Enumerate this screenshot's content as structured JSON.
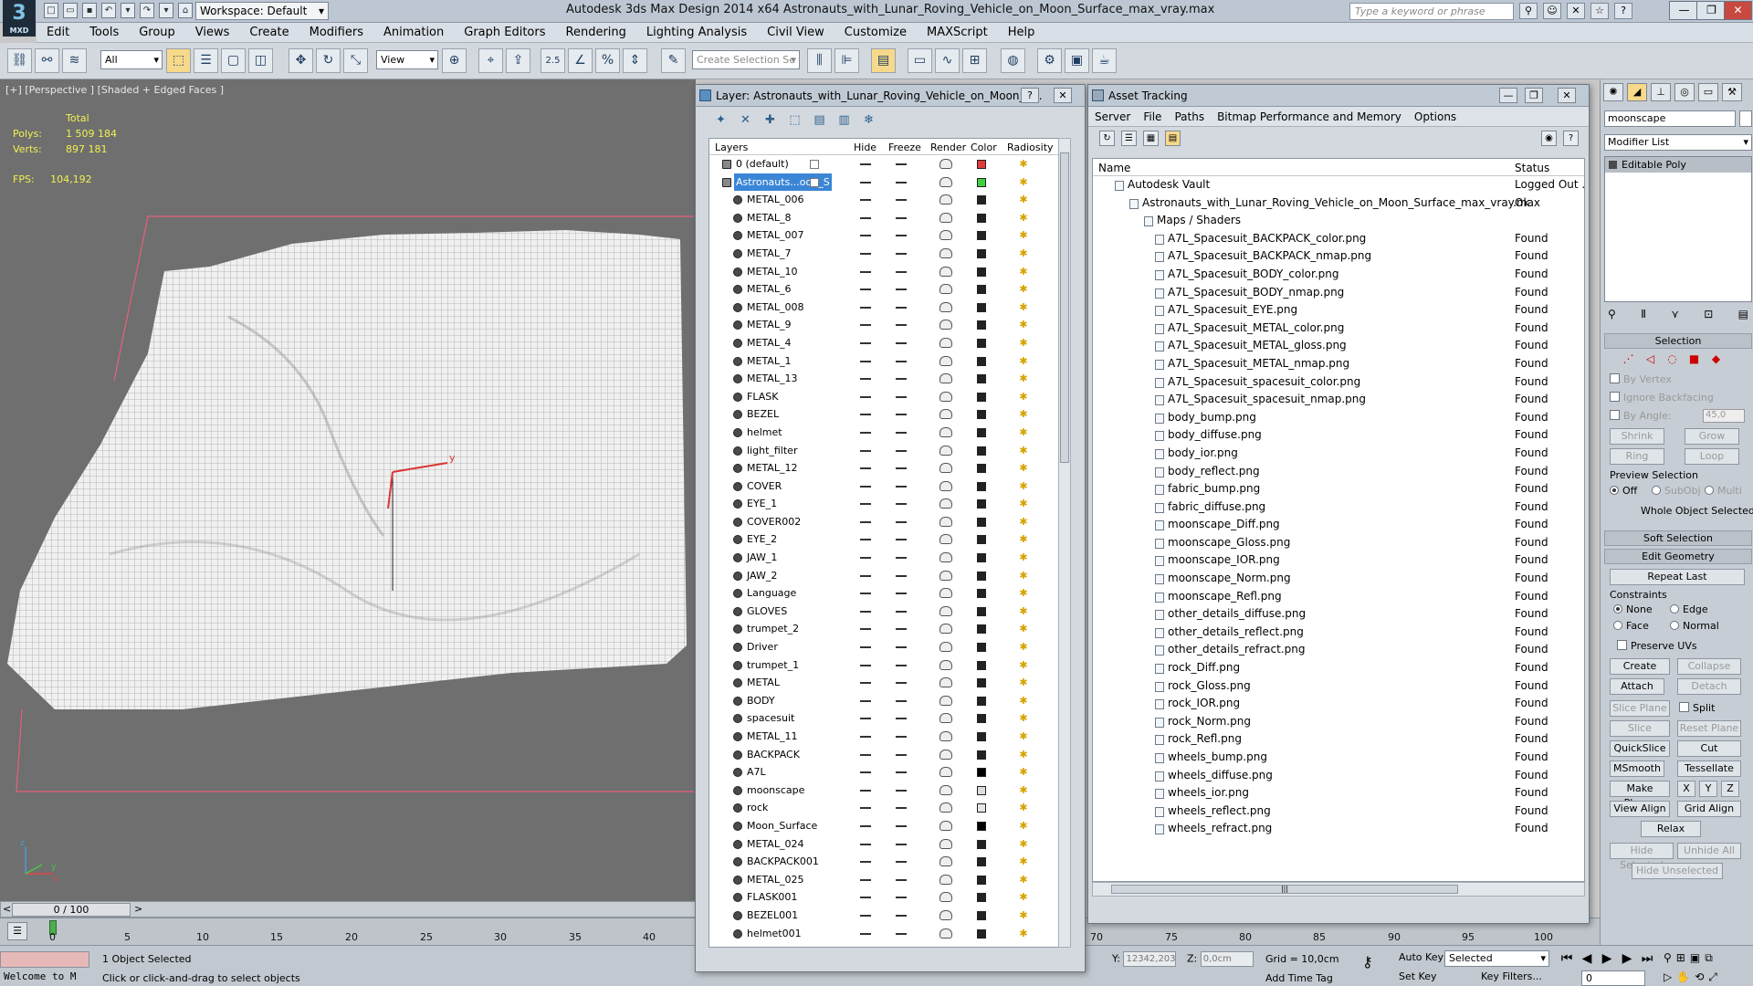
{
  "title": {
    "app_logo": "MXD",
    "workspace": "Workspace: Default",
    "window_title": "Autodesk 3ds Max Design 2014 x64     Astronauts_with_Lunar_Roving_Vehicle_on_Moon_Surface_max_vray.max",
    "search_placeholder": "Type a keyword or phrase"
  },
  "menu": [
    "Edit",
    "Tools",
    "Group",
    "Views",
    "Create",
    "Modifiers",
    "Animation",
    "Graph Editors",
    "Rendering",
    "Lighting Analysis",
    "Civil View",
    "Customize",
    "MAXScript",
    "Help"
  ],
  "toolbar": {
    "filter": "All",
    "ref_coord": "View",
    "snap_value": "2.5",
    "selection_set_placeholder": "Create Selection Se"
  },
  "viewport": {
    "label": "[+] [Perspective ] [Shaded + Edged Faces ]",
    "total_label": "Total",
    "polys_label": "Polys:",
    "polys_value": "1 509 184",
    "verts_label": "Verts:",
    "verts_value": "897 181",
    "fps_label": "FPS:",
    "fps_value": "104,192",
    "axis_x": "x",
    "axis_y": "y",
    "axis_z": "z"
  },
  "timeline": {
    "frame_counter": "0 / 100",
    "ticks": [
      "0",
      "5",
      "10",
      "15",
      "20",
      "25",
      "30",
      "35",
      "40",
      "70",
      "75",
      "80",
      "85",
      "90",
      "95",
      "100"
    ]
  },
  "layer_window": {
    "title": "Layer: Astronauts_with_Lunar_Roving_Vehicle_on_Moon_S...",
    "columns": {
      "layers": "Layers",
      "hide": "Hide",
      "freeze": "Freeze",
      "render": "Render",
      "color": "Color",
      "radiosity": "Radiosity"
    },
    "rows": [
      {
        "name": "0 (default)",
        "color": "#e03a3a",
        "level": 0
      },
      {
        "name": "Astronauts...oon_S",
        "color": "#3fcf3f",
        "level": 0,
        "selected": true
      },
      {
        "name": "METAL_006",
        "color": "#222222",
        "level": 1
      },
      {
        "name": "METAL_8",
        "color": "#222222",
        "level": 1
      },
      {
        "name": "METAL_007",
        "color": "#222222",
        "level": 1
      },
      {
        "name": "METAL_7",
        "color": "#222222",
        "level": 1
      },
      {
        "name": "METAL_10",
        "color": "#222222",
        "level": 1
      },
      {
        "name": "METAL_6",
        "color": "#222222",
        "level": 1
      },
      {
        "name": "METAL_008",
        "color": "#222222",
        "level": 1
      },
      {
        "name": "METAL_9",
        "color": "#222222",
        "level": 1
      },
      {
        "name": "METAL_4",
        "color": "#222222",
        "level": 1
      },
      {
        "name": "METAL_1",
        "color": "#222222",
        "level": 1
      },
      {
        "name": "METAL_13",
        "color": "#222222",
        "level": 1
      },
      {
        "name": "FLASK",
        "color": "#222222",
        "level": 1
      },
      {
        "name": "BEZEL",
        "color": "#222222",
        "level": 1
      },
      {
        "name": "helmet",
        "color": "#222222",
        "level": 1
      },
      {
        "name": "light_filter",
        "color": "#222222",
        "level": 1
      },
      {
        "name": "METAL_12",
        "color": "#222222",
        "level": 1
      },
      {
        "name": "COVER",
        "color": "#222222",
        "level": 1
      },
      {
        "name": "EYE_1",
        "color": "#222222",
        "level": 1
      },
      {
        "name": "COVER002",
        "color": "#222222",
        "level": 1
      },
      {
        "name": "EYE_2",
        "color": "#222222",
        "level": 1
      },
      {
        "name": "JAW_1",
        "color": "#222222",
        "level": 1
      },
      {
        "name": "JAW_2",
        "color": "#222222",
        "level": 1
      },
      {
        "name": "Language",
        "color": "#222222",
        "level": 1
      },
      {
        "name": "GLOVES",
        "color": "#222222",
        "level": 1
      },
      {
        "name": "trumpet_2",
        "color": "#222222",
        "level": 1
      },
      {
        "name": "Driver",
        "color": "#222222",
        "level": 1
      },
      {
        "name": "trumpet_1",
        "color": "#222222",
        "level": 1
      },
      {
        "name": "METAL",
        "color": "#222222",
        "level": 1
      },
      {
        "name": "BODY",
        "color": "#222222",
        "level": 1
      },
      {
        "name": "spacesuit",
        "color": "#222222",
        "level": 1
      },
      {
        "name": "METAL_11",
        "color": "#222222",
        "level": 1
      },
      {
        "name": "BACKPACK",
        "color": "#222222",
        "level": 1
      },
      {
        "name": "A7L",
        "color": "#000000",
        "level": 1
      },
      {
        "name": "moonscape",
        "color": "#dddddd",
        "level": 1
      },
      {
        "name": "rock",
        "color": "#e6e6e6",
        "level": 1
      },
      {
        "name": "Moon_Surface",
        "color": "#000000",
        "level": 1
      },
      {
        "name": "METAL_024",
        "color": "#222222",
        "level": 1
      },
      {
        "name": "BACKPACK001",
        "color": "#222222",
        "level": 1
      },
      {
        "name": "METAL_025",
        "color": "#222222",
        "level": 1
      },
      {
        "name": "FLASK001",
        "color": "#222222",
        "level": 1
      },
      {
        "name": "BEZEL001",
        "color": "#222222",
        "level": 1
      },
      {
        "name": "helmet001",
        "color": "#222222",
        "level": 1
      }
    ]
  },
  "asset_window": {
    "title": "Asset Tracking",
    "menu": [
      "Server",
      "File",
      "Paths",
      "Bitmap Performance and Memory",
      "Options"
    ],
    "col_name": "Name",
    "col_status": "Status",
    "rows": [
      {
        "name": "Autodesk Vault",
        "status": "Logged Out ...",
        "level": 0
      },
      {
        "name": "Astronauts_with_Lunar_Roving_Vehicle_on_Moon_Surface_max_vray.max",
        "status": "Ok",
        "level": 1
      },
      {
        "name": "Maps / Shaders",
        "status": "",
        "level": 2
      },
      {
        "name": "A7L_Spacesuit_BACKPACK_color.png",
        "status": "Found",
        "level": 3
      },
      {
        "name": "A7L_Spacesuit_BACKPACK_nmap.png",
        "status": "Found",
        "level": 3
      },
      {
        "name": "A7L_Spacesuit_BODY_color.png",
        "status": "Found",
        "level": 3
      },
      {
        "name": "A7L_Spacesuit_BODY_nmap.png",
        "status": "Found",
        "level": 3
      },
      {
        "name": "A7L_Spacesuit_EYE.png",
        "status": "Found",
        "level": 3
      },
      {
        "name": "A7L_Spacesuit_METAL_color.png",
        "status": "Found",
        "level": 3
      },
      {
        "name": "A7L_Spacesuit_METAL_gloss.png",
        "status": "Found",
        "level": 3
      },
      {
        "name": "A7L_Spacesuit_METAL_nmap.png",
        "status": "Found",
        "level": 3
      },
      {
        "name": "A7L_Spacesuit_spacesuit_color.png",
        "status": "Found",
        "level": 3
      },
      {
        "name": "A7L_Spacesuit_spacesuit_nmap.png",
        "status": "Found",
        "level": 3
      },
      {
        "name": "body_bump.png",
        "status": "Found",
        "level": 3
      },
      {
        "name": "body_diffuse.png",
        "status": "Found",
        "level": 3
      },
      {
        "name": "body_ior.png",
        "status": "Found",
        "level": 3
      },
      {
        "name": "body_reflect.png",
        "status": "Found",
        "level": 3
      },
      {
        "name": "fabric_bump.png",
        "status": "Found",
        "level": 3
      },
      {
        "name": "fabric_diffuse.png",
        "status": "Found",
        "level": 3
      },
      {
        "name": "moonscape_Diff.png",
        "status": "Found",
        "level": 3
      },
      {
        "name": "moonscape_Gloss.png",
        "status": "Found",
        "level": 3
      },
      {
        "name": "moonscape_IOR.png",
        "status": "Found",
        "level": 3
      },
      {
        "name": "moonscape_Norm.png",
        "status": "Found",
        "level": 3
      },
      {
        "name": "moonscape_Refl.png",
        "status": "Found",
        "level": 3
      },
      {
        "name": "other_details_diffuse.png",
        "status": "Found",
        "level": 3
      },
      {
        "name": "other_details_reflect.png",
        "status": "Found",
        "level": 3
      },
      {
        "name": "other_details_refract.png",
        "status": "Found",
        "level": 3
      },
      {
        "name": "rock_Diff.png",
        "status": "Found",
        "level": 3
      },
      {
        "name": "rock_Gloss.png",
        "status": "Found",
        "level": 3
      },
      {
        "name": "rock_IOR.png",
        "status": "Found",
        "level": 3
      },
      {
        "name": "rock_Norm.png",
        "status": "Found",
        "level": 3
      },
      {
        "name": "rock_Refl.png",
        "status": "Found",
        "level": 3
      },
      {
        "name": "wheels_bump.png",
        "status": "Found",
        "level": 3
      },
      {
        "name": "wheels_diffuse.png",
        "status": "Found",
        "level": 3
      },
      {
        "name": "wheels_ior.png",
        "status": "Found",
        "level": 3
      },
      {
        "name": "wheels_reflect.png",
        "status": "Found",
        "level": 3
      },
      {
        "name": "wheels_refract.png",
        "status": "Found",
        "level": 3
      }
    ]
  },
  "command_panel": {
    "object_name": "moonscape",
    "modifier_list": "Modifier List",
    "stack_item": "Editable Poly",
    "selection_title": "Selection",
    "by_vertex": "By Vertex",
    "ignore_backfacing": "Ignore Backfacing",
    "by_angle": "By Angle:",
    "by_angle_value": "45,0",
    "shrink": "Shrink",
    "grow": "Grow",
    "ring": "Ring",
    "loop": "Loop",
    "preview_selection": "Preview Selection",
    "off": "Off",
    "subobj": "SubObj",
    "multi": "Multi",
    "whole_object_selected": "Whole Object Selected",
    "soft_selection": "Soft Selection",
    "edit_geometry": "Edit Geometry",
    "repeat_last": "Repeat Last",
    "constraints": "Constraints",
    "none": "None",
    "edge": "Edge",
    "face": "Face",
    "normal": "Normal",
    "preserve_uvs": "Preserve UVs",
    "create": "Create",
    "collapse": "Collapse",
    "attach": "Attach",
    "detach": "Detach",
    "slice_plane": "Slice Plane",
    "split": "Split",
    "slice": "Slice",
    "reset_plane": "Reset Plane",
    "quickslice": "QuickSlice",
    "cut": "Cut",
    "msmooth": "MSmooth",
    "tessellate": "Tessellate",
    "make_planar": "Make Planar",
    "x": "X",
    "y": "Y",
    "z": "Z",
    "view_align": "View Align",
    "grid_align": "Grid Align",
    "relax": "Relax",
    "hide_selected": "Hide Selected",
    "unhide_all": "Unhide All",
    "hide_unselected": "Hide Unselected"
  },
  "status": {
    "welcome": "Welcome to M",
    "selection": "1 Object Selected",
    "prompt": "Click or click-and-drag to select objects",
    "y_label": "Y:",
    "y_value": "12342,203",
    "z_label": "Z:",
    "z_value": "0,0cm",
    "grid": "Grid = 10,0cm",
    "add_time_tag": "Add Time Tag",
    "auto_key": "Auto Key",
    "set_key": "Set Key",
    "key_mode": "Selected",
    "key_filters": "Key Filters...",
    "frame": "0"
  },
  "colors": {
    "accent": "#3a86d6",
    "stats": "#f1f150",
    "viewport_bg": "#6f6f6f"
  }
}
